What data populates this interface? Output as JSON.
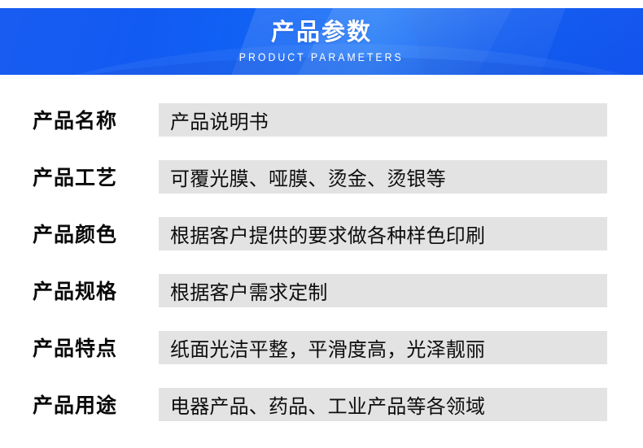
{
  "banner": {
    "title": "产品参数",
    "subtitle": "PRODUCT PARAMETERS",
    "gradient_start": "#0a52f0",
    "gradient_end": "#0a4fef",
    "text_color": "#ffffff"
  },
  "spec_table": {
    "value_background": "#e3e3e3",
    "text_color": "#0d0d0d",
    "rows": [
      {
        "label": "产品名称",
        "value": "产品说明书"
      },
      {
        "label": "产品工艺",
        "value": "可覆光膜、哑膜、烫金、烫银等"
      },
      {
        "label": "产品颜色",
        "value": "根据客户提供的要求做各种样色印刷"
      },
      {
        "label": "产品规格",
        "value": "根据客户需求定制"
      },
      {
        "label": "产品特点",
        "value": "纸面光洁平整，平滑度高，光泽靓丽"
      },
      {
        "label": "产品用途",
        "value": "电器产品、药品、工业产品等各领域"
      }
    ]
  }
}
